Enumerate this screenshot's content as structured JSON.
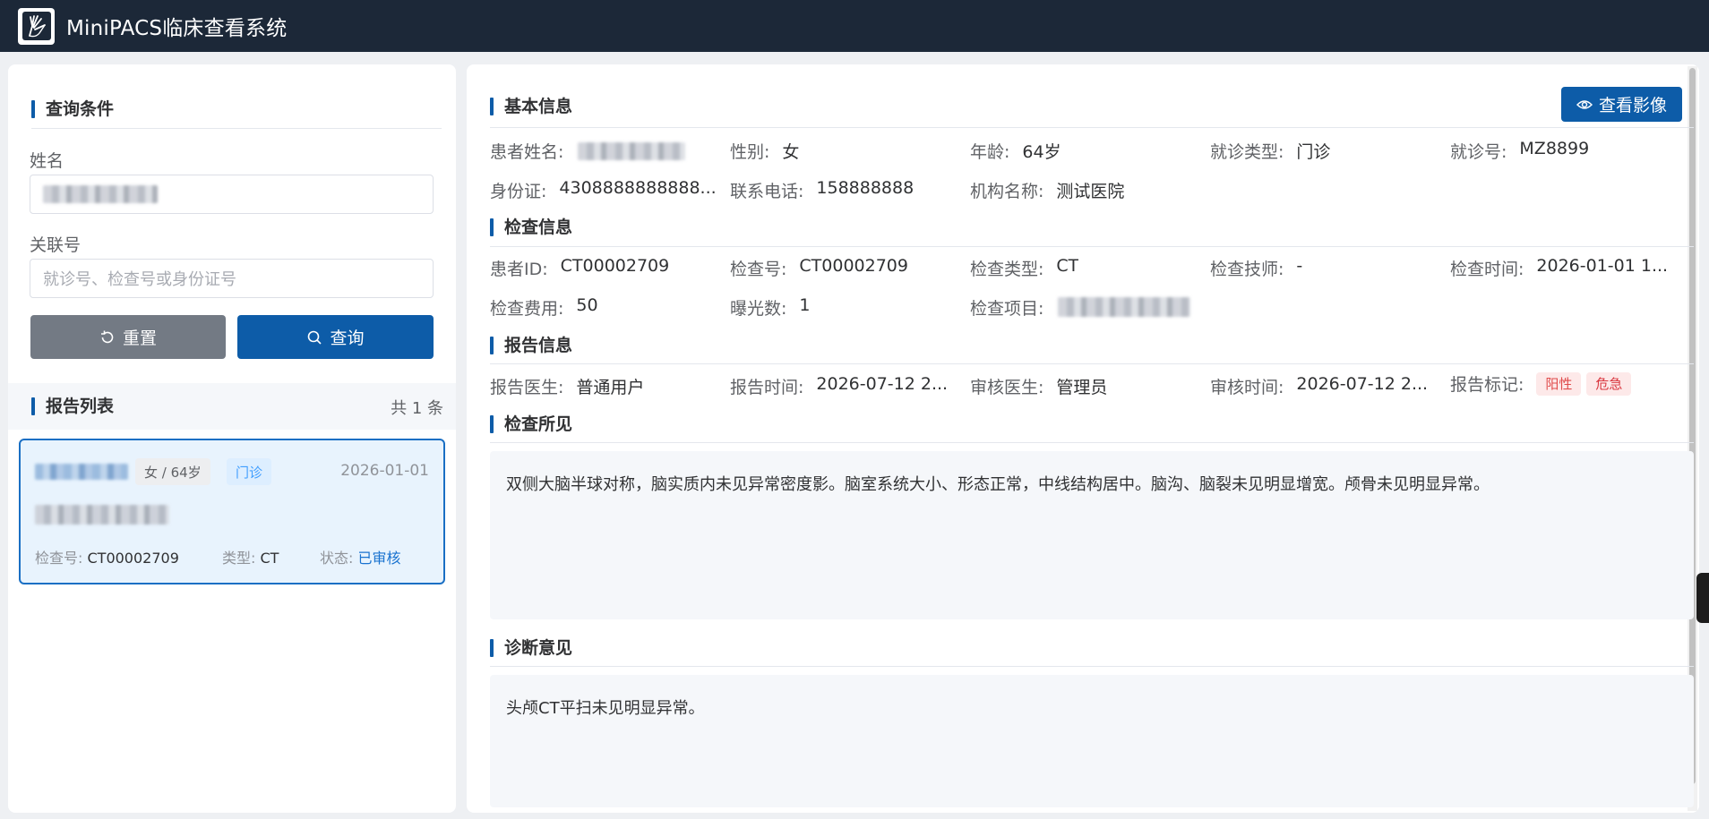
{
  "app": {
    "title": "MiniPACS临床查看系统",
    "logo_icon": "xray-hand-icon"
  },
  "query": {
    "section_title": "查询条件",
    "name_label": "姓名",
    "name_value": "",
    "link_label": "关联号",
    "link_placeholder": "就诊号、检查号或身份证号",
    "reset_label": "重置",
    "search_label": "查询"
  },
  "report_list": {
    "title": "报告列表",
    "count_text": "共 1 条",
    "items": [
      {
        "gender_age": "女 / 64岁",
        "visit_type": "门诊",
        "date": "2026-01-01",
        "exam_no_label": "检查号:",
        "exam_no": "CT00002709",
        "type_label": "类型:",
        "type": "CT",
        "status_label": "状态:",
        "status": "已审核"
      }
    ]
  },
  "basic": {
    "title": "基本信息",
    "view_images_label": "查看影像",
    "patient_name_label": "患者姓名:",
    "gender_label": "性别:",
    "gender": "女",
    "age_label": "年龄:",
    "age": "64岁",
    "visit_type_label": "就诊类型:",
    "visit_type": "门诊",
    "visit_no_label": "就诊号:",
    "visit_no": "MZ8899",
    "id_card_label": "身份证:",
    "id_card": "4308888888888...",
    "phone_label": "联系电话:",
    "phone": "158888888",
    "org_label": "机构名称:",
    "org": "测试医院"
  },
  "exam": {
    "title": "检查信息",
    "patient_id_label": "患者ID:",
    "patient_id": "CT00002709",
    "exam_no_label": "检查号:",
    "exam_no": "CT00002709",
    "exam_type_label": "检查类型:",
    "exam_type": "CT",
    "tech_label": "检查技师:",
    "tech": "-",
    "exam_time_label": "检查时间:",
    "exam_time": "2026-01-01 1...",
    "fee_label": "检查费用:",
    "fee": "50",
    "exposure_label": "曝光数:",
    "exposure": "1",
    "item_label": "检查项目:"
  },
  "report": {
    "title": "报告信息",
    "doctor_label": "报告医生:",
    "doctor": "普通用户",
    "report_time_label": "报告时间:",
    "report_time": "2026-07-12 2...",
    "reviewer_label": "审核医生:",
    "reviewer": "管理员",
    "review_time_label": "审核时间:",
    "review_time": "2026-07-12 2...",
    "flag_label": "报告标记:",
    "flags": [
      "阳性",
      "危急"
    ]
  },
  "findings": {
    "title": "检查所见",
    "text": "双侧大脑半球对称，脑实质内未见异常密度影。脑室系统大小、形态正常，中线结构居中。脑沟、脑裂未见明显增宽。颅骨未见明显异常。"
  },
  "diagnosis": {
    "title": "诊断意见",
    "text": "头颅CT平扫未见明显异常。"
  }
}
